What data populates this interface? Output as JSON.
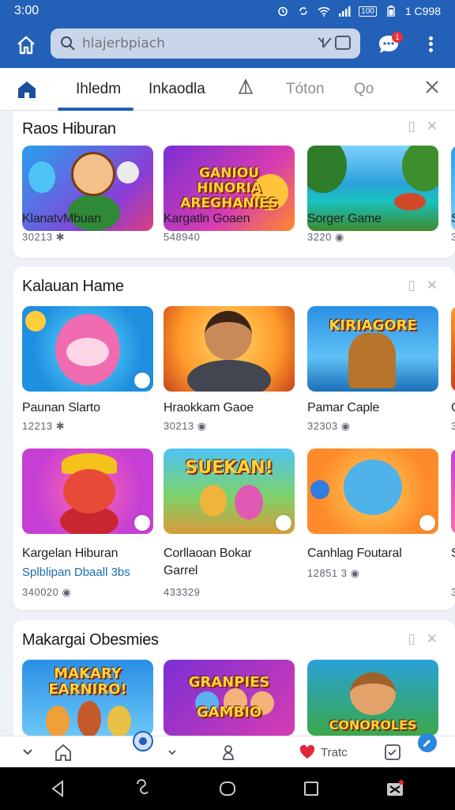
{
  "status_bar": {
    "time": "3:00",
    "battery_label": "100",
    "right_text": "1 C998"
  },
  "search": {
    "placeholder": "hlajerbpiach"
  },
  "chat": {
    "badge": "1"
  },
  "tabs": [
    {
      "label": "Ihledm",
      "active": true
    },
    {
      "label": "Inkaodla",
      "active": false
    },
    {
      "label": "Tóton",
      "active": false
    },
    {
      "label": "Qo",
      "active": false
    }
  ],
  "sections": [
    {
      "title": "Raos Hiburan",
      "cards": [
        {
          "title": "KlanatvMbuan",
          "count": "30213 ✱"
        },
        {
          "title": "Kargatln Goaen",
          "count": "548940"
        },
        {
          "title": "Sorger Game",
          "count": "3220 ◉"
        },
        {
          "title": "S",
          "count": "3"
        }
      ]
    },
    {
      "title": "Kalauan Hame",
      "cards": [
        {
          "title": "Paunan Slarto",
          "count": "12213 ✱"
        },
        {
          "title": "Hraokkam Gaoe",
          "count": "30213 ◉"
        },
        {
          "title": "Pamar Caple",
          "count": "32303 ◉"
        },
        {
          "title": "C",
          "count": "3"
        }
      ],
      "cards_row2": [
        {
          "title": "Kargelan Hiburan",
          "subtitle": "Splblipan Dbaall 3bs",
          "count": "340020 ◉",
          "art": ""
        },
        {
          "title": "Corllaoan Bokar",
          "subtitle": "Garrel",
          "count": "433329",
          "art": "SUEKAN!"
        },
        {
          "title": "Canhlag Foutaral",
          "count": "12851 3 ◉",
          "art": ""
        },
        {
          "title": "S",
          "count": "3"
        }
      ]
    },
    {
      "title": "Makargai Obesmies",
      "cards": [
        {
          "art": "MAKARY EARNIRO!"
        },
        {
          "art": "GRANPIES GAMBIO"
        },
        {
          "art": "CONOROLES"
        }
      ]
    }
  ],
  "art": {
    "s1c2": "GANIOU HINORIA AREGHANIES",
    "s2c3": "KIRIAGORE"
  },
  "bottom_bar": {
    "label": "Tratc"
  },
  "colors": {
    "brand": "#2360b8",
    "active_tab": "#2360b8"
  }
}
